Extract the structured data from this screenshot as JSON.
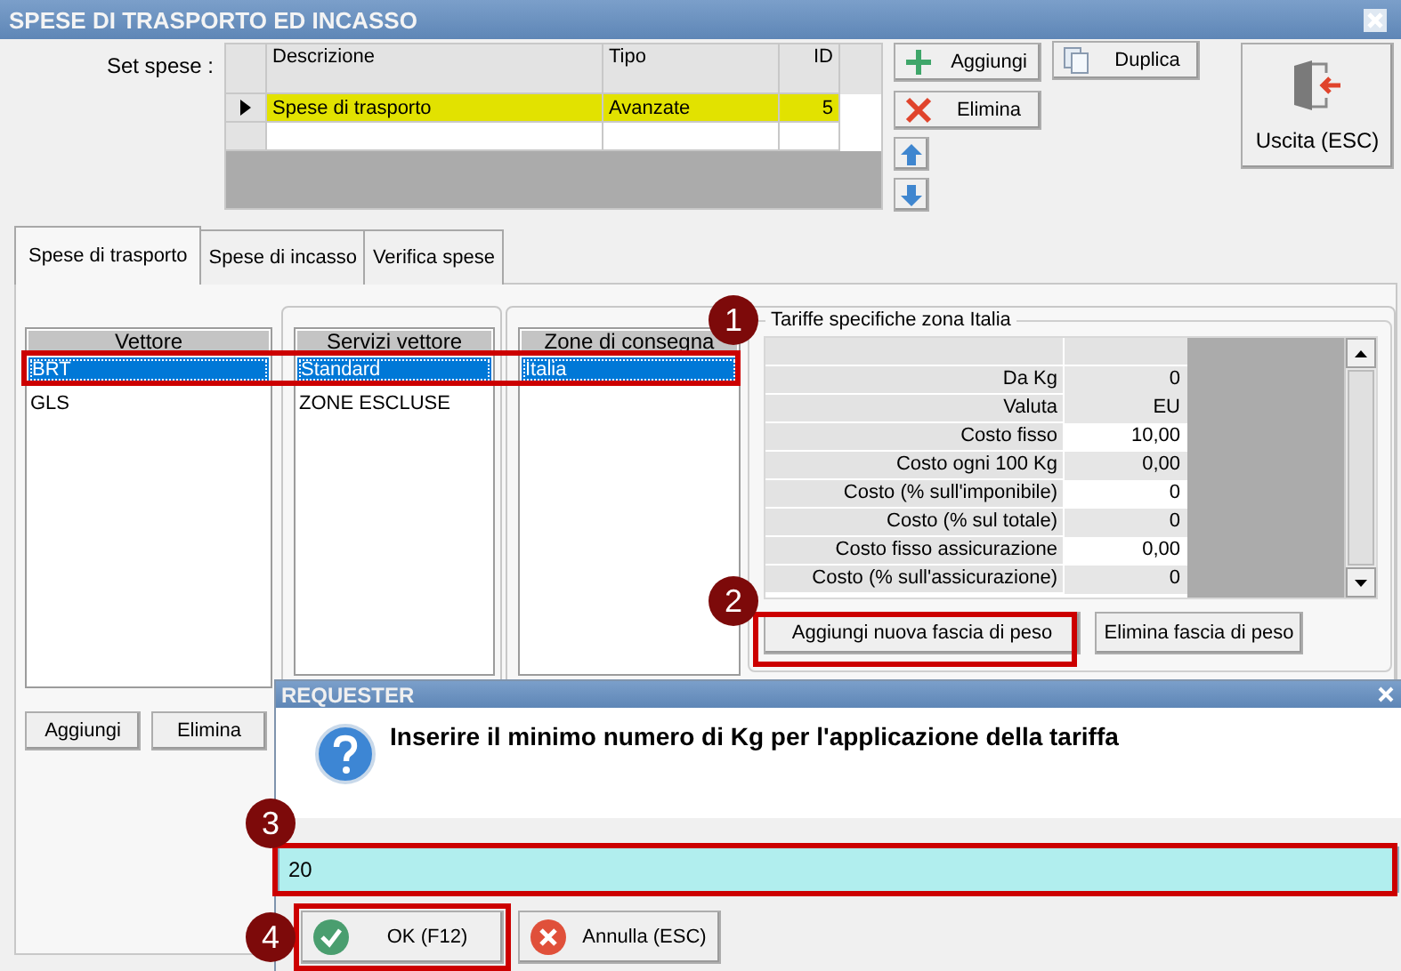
{
  "window": {
    "title": "SPESE DI TRASPORTO ED INCASSO"
  },
  "set_spese": {
    "label": "Set spese :",
    "columns": [
      "Descrizione",
      "Tipo",
      "ID"
    ],
    "rows": [
      {
        "descrizione": "Spese di trasporto",
        "tipo": "Avanzate",
        "id": "5",
        "selected": true
      }
    ]
  },
  "actions": [
    {
      "label": "Aggiungi",
      "kind": "add"
    },
    {
      "label": "Duplica",
      "kind": "duplicate"
    },
    {
      "label": "Elimina",
      "kind": "delete"
    }
  ],
  "exit_button": {
    "label": "Uscita (ESC)"
  },
  "tabs": [
    {
      "label": "Spese di trasporto",
      "selected": true
    },
    {
      "label": "Spese di incasso",
      "selected": false
    },
    {
      "label": "Verifica spese",
      "selected": false
    }
  ],
  "lists": [
    {
      "header": "Vettore",
      "items": [
        {
          "label": "BRT",
          "selected": true
        },
        {
          "label": "GLS",
          "selected": false
        }
      ]
    },
    {
      "header": "Servizi vettore",
      "items": [
        {
          "label": "Standard",
          "selected": true
        },
        {
          "label": "ZONE ESCLUSE",
          "selected": false
        }
      ]
    },
    {
      "header": "Zone di consegna",
      "items": [
        {
          "label": "Italia",
          "selected": true
        }
      ]
    }
  ],
  "list_buttons": [
    "Aggiungi",
    "Elimina"
  ],
  "tariffe": {
    "title": "Tariffe specifiche zona Italia",
    "rows": [
      {
        "label": "Da Kg",
        "value": "0",
        "shaded": true
      },
      {
        "label": "Valuta",
        "value": "EU",
        "shaded": true
      },
      {
        "label": "Costo fisso",
        "value": "10,00",
        "shaded": false
      },
      {
        "label": "Costo ogni 100 Kg",
        "value": "0,00",
        "shaded": true
      },
      {
        "label": "Costo (% sull'imponibile)",
        "value": "0",
        "shaded": false
      },
      {
        "label": "Costo (% sul totale)",
        "value": "0",
        "shaded": true
      },
      {
        "label": "Costo fisso assicurazione",
        "value": "0,00",
        "shaded": false
      },
      {
        "label": "Costo (% sull'assicurazione)",
        "value": "0",
        "shaded": true
      }
    ],
    "buttons": [
      "Aggiungi nuova fascia di peso",
      "Elimina fascia di peso"
    ]
  },
  "requester": {
    "title": "REQUESTER",
    "message": "Inserire il minimo numero di Kg per l'applicazione della tariffa",
    "value": "20",
    "buttons": [
      {
        "label": "OK (F12)",
        "kind": "ok"
      },
      {
        "label": "Annulla (ESC)",
        "kind": "cancel"
      }
    ]
  },
  "annotations": [
    {
      "number": "1"
    },
    {
      "number": "2"
    },
    {
      "number": "3"
    },
    {
      "number": "4"
    }
  ]
}
